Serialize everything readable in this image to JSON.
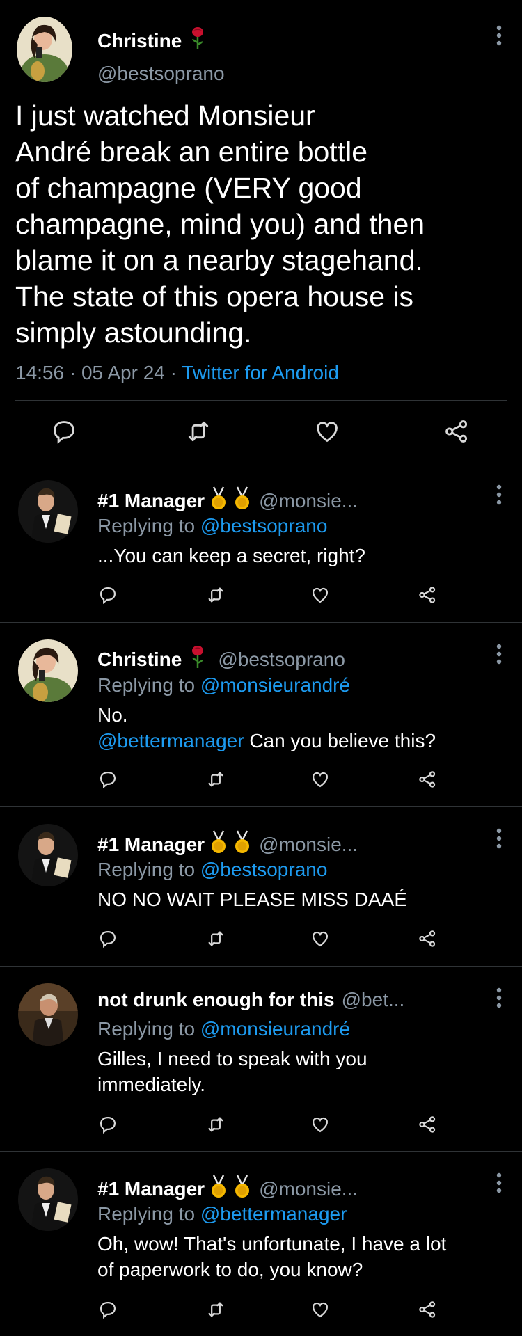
{
  "main_tweet": {
    "name": "Christine",
    "handle": "@bestsoprano",
    "text_lines": [
      "I just watched Monsieur",
      "André break an entire bottle",
      "of champagne (VERY good",
      "champagne, mind you) and then",
      "blame it on a nearby stagehand.",
      "The state of this opera house is",
      "simply astounding."
    ],
    "time": "14:56",
    "dot1": "·",
    "date": "05 Apr 24",
    "dot2": "·",
    "source": "Twitter for Android",
    "actions": [
      "reply-icon",
      "retweet-icon",
      "like-icon",
      "share-icon"
    ]
  },
  "replies": [
    {
      "name": "#1 Manager",
      "handle": "@monsie...",
      "replying_label": "Replying to",
      "replying_to": "@bestsoprano",
      "lines": [
        [
          "...You can keep a secret, right?"
        ]
      ]
    },
    {
      "name": "Christine",
      "handle": "@bestsoprano",
      "replying_label": "Replying to",
      "replying_to": "@monsieurandré",
      "lines": [
        [
          "No."
        ],
        [
          "@bettermanager",
          " Can you believe this?"
        ]
      ]
    },
    {
      "name": "#1 Manager",
      "handle": "@monsie...",
      "replying_label": "Replying to",
      "replying_to": "@bestsoprano",
      "lines": [
        [
          "NO NO WAIT PLEASE MISS DAAÉ"
        ]
      ]
    },
    {
      "name": "not drunk enough for this",
      "handle": "@bet...",
      "replying_label": "Replying to",
      "replying_to": "@monsieurandré",
      "lines": [
        [
          "Gilles, I need to speak with you"
        ],
        [
          "immediately."
        ]
      ]
    },
    {
      "name": "#1 Manager",
      "handle": "@monsie...",
      "replying_label": "Replying to",
      "replying_to": "@bettermanager",
      "lines": [
        [
          "Oh, wow! That's unfortunate, I have a lot"
        ],
        [
          "of paperwork to do, you know?"
        ]
      ]
    }
  ],
  "colors": {
    "background": "#000000",
    "text": "#ffffff",
    "secondary": "#8b98a5",
    "link": "#1d9bf0",
    "divider": "#2f3336"
  }
}
